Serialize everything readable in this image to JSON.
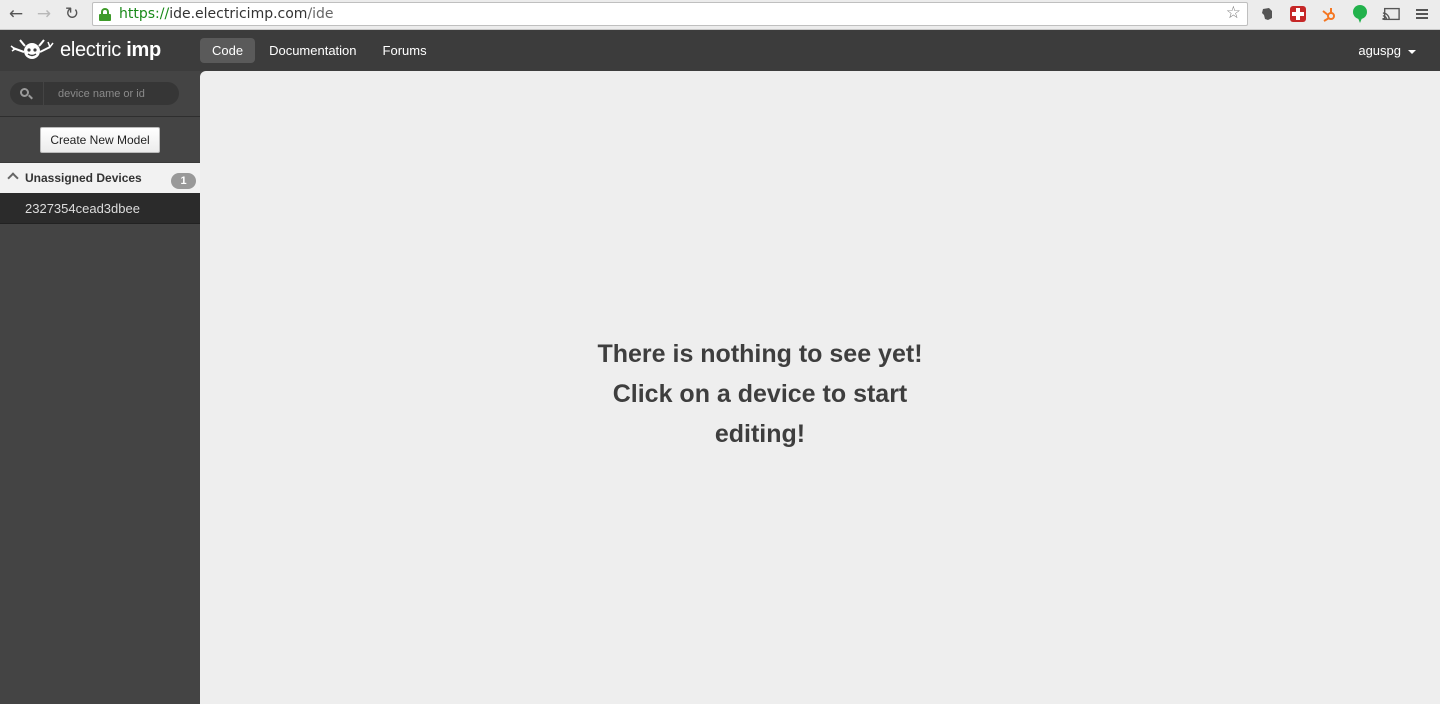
{
  "browser": {
    "url_scheme": "https://",
    "url_host": "ide.electricimp.com",
    "url_path": "/ide",
    "icons": [
      "back-arrow-icon",
      "forward-arrow-icon",
      "reload-icon",
      "lock-icon",
      "bookmark-star-icon",
      "evernote-icon",
      "lastpass-icon",
      "hubspot-icon",
      "bubble-icon",
      "cast-icon",
      "menu-icon"
    ]
  },
  "header": {
    "logo_light": "electric ",
    "logo_bold": "imp",
    "nav": [
      {
        "label": "Code"
      },
      {
        "label": "Documentation"
      },
      {
        "label": "Forums"
      }
    ],
    "user": "aguspg"
  },
  "sidebar": {
    "search_placeholder": "device name or id",
    "create_button": "Create New Model",
    "groups": [
      {
        "label": "Unassigned Devices",
        "count": "1",
        "devices": [
          {
            "id": "2327354cead3dbee"
          }
        ]
      }
    ]
  },
  "main": {
    "empty_line_1": "There is nothing to see yet!",
    "empty_line_2": "Click on a device to start",
    "empty_line_3": "editing!"
  },
  "colors": {
    "header_bg": "#3c3c3c",
    "sidebar_bg": "#444444",
    "main_bg": "#eeeeee",
    "url_scheme_green": "#1a8a1a"
  }
}
